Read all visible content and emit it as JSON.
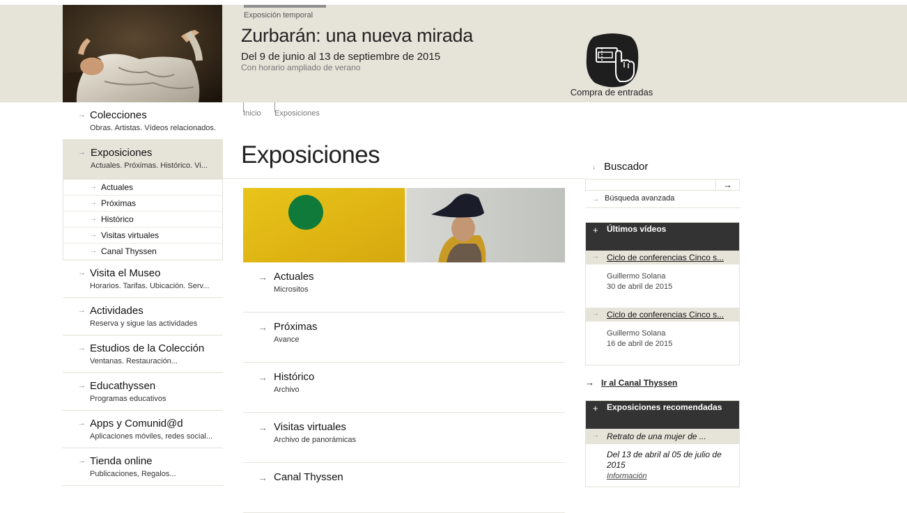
{
  "banner": {
    "exhibition_type": "Exposición temporal",
    "title": "Zurbarán: una nueva mirada",
    "dates": "Del 9 de junio al 13 de septiembre de 2015",
    "hours": "Con horario ampliado de verano",
    "ticket_label": "Compra de entradas",
    "ticket_icon": "ticket-hand-icon"
  },
  "nav": {
    "colecciones": {
      "title": "Colecciones",
      "subtitle": "Obras. Artistas. Vídeos relacionados."
    },
    "exposiciones": {
      "title": "Exposiciones",
      "subtitle": "Actuales. Próximas. Histórico. Vi...",
      "subitems": [
        "Actuales",
        "Próximas",
        "Histórico",
        "Visitas virtuales",
        "Canal Thyssen"
      ]
    },
    "items": [
      {
        "title": "Visita el Museo",
        "subtitle": "Horarios. Tarifas. Ubicación. Serv..."
      },
      {
        "title": "Actividades",
        "subtitle": "Reserva y sigue las actividades"
      },
      {
        "title": "Estudios de la Colección",
        "subtitle": "Ventanas. Restauración..."
      },
      {
        "title": "Educathyssen",
        "subtitle": "Programas educativos"
      },
      {
        "title": "Apps y Comunid@d",
        "subtitle": "Aplicaciones móviles, redes social..."
      },
      {
        "title": "Tienda online",
        "subtitle": "Publicaciones, Regalos..."
      }
    ]
  },
  "breadcrumb": [
    "Inicio",
    "Exposiciones"
  ],
  "page_title": "Exposiciones",
  "main_list": [
    {
      "title": "Actuales",
      "subtitle": "Micrositos"
    },
    {
      "title": "Próximas",
      "subtitle": "Avance"
    },
    {
      "title": "Histórico",
      "subtitle": "Archivo"
    },
    {
      "title": "Visitas virtuales",
      "subtitle": "Archivo de panorámicas"
    },
    {
      "title": "Canal Thyssen",
      "subtitle": ""
    }
  ],
  "search": {
    "label": "Buscador",
    "placeholder": "",
    "advanced": "Búsqueda avanzada",
    "submit_symbol": "→"
  },
  "videos": {
    "heading": "Últimos vídeos",
    "items": [
      {
        "title": "Ciclo de conferencias Cinco s...",
        "author": "Guillermo Solana",
        "date": "30 de abril de 2015"
      },
      {
        "title": "Ciclo de conferencias Cinco s...",
        "author": "Guillermo Solana",
        "date": "16 de abril de 2015"
      }
    ]
  },
  "canal_link": "Ir al Canal Thyssen",
  "recommended": {
    "heading": "Exposiciones recomendadas",
    "title": "Retrato de una mujer de ...",
    "dates": "Del 13 de abril al 05 de julio de 2015",
    "info": "Información"
  },
  "colors": {
    "banner_bg": "#e6e3d8",
    "panel_head": "#333333",
    "active_nav": "#e6e3d8"
  }
}
